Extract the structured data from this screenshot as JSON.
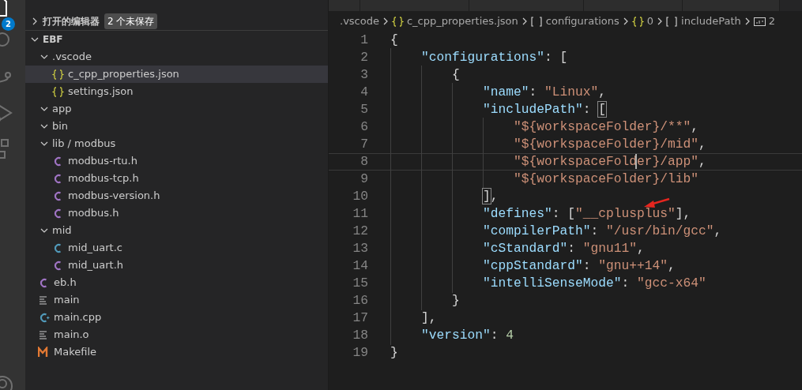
{
  "activity_bar": {
    "items": [
      {
        "kind": "explorer",
        "selected": true,
        "badge": "2"
      },
      {
        "kind": "search",
        "selected": false
      },
      {
        "kind": "source-control",
        "selected": false
      },
      {
        "kind": "run",
        "selected": false
      },
      {
        "kind": "extensions",
        "selected": false
      },
      {
        "kind": "account",
        "selected": false
      }
    ]
  },
  "sidebar": {
    "open_editors": {
      "label": "打开的编辑器",
      "expanded": false,
      "badge": "2 个未保存"
    },
    "root": {
      "label": "EBF",
      "expanded": true,
      "children": [
        {
          "label": ".vscode",
          "kind": "folder",
          "expanded": true,
          "children": [
            {
              "label": "c_cpp_properties.json",
              "kind": "json",
              "selected": true
            },
            {
              "label": "settings.json",
              "kind": "json",
              "selected": false
            }
          ]
        },
        {
          "label": "app",
          "kind": "folder",
          "expanded": true
        },
        {
          "label": "bin",
          "kind": "folder",
          "expanded": true
        },
        {
          "label": "lib / modbus",
          "kind": "folder",
          "expanded": true,
          "children": [
            {
              "label": "modbus-rtu.h",
              "kind": "c-header",
              "selected": false
            },
            {
              "label": "modbus-tcp.h",
              "kind": "c-header",
              "selected": false
            },
            {
              "label": "modbus-version.h",
              "kind": "c-header",
              "selected": false
            },
            {
              "label": "modbus.h",
              "kind": "c-header",
              "selected": false
            }
          ]
        },
        {
          "label": "mid",
          "kind": "folder",
          "expanded": true,
          "children": [
            {
              "label": "mid_uart.c",
              "kind": "c-source",
              "selected": false
            },
            {
              "label": "mid_uart.h",
              "kind": "c-header",
              "selected": false
            }
          ]
        },
        {
          "label": "eb.h",
          "kind": "c-header",
          "selected": false
        },
        {
          "label": "main",
          "kind": "text",
          "selected": false
        },
        {
          "label": "main.cpp",
          "kind": "cpp",
          "selected": false
        },
        {
          "label": "main.o",
          "kind": "text",
          "selected": false
        },
        {
          "label": "Makefile",
          "kind": "makefile",
          "selected": false
        }
      ]
    }
  },
  "editor": {
    "breadcrumb": [
      {
        "kind": "folder",
        "label": ".vscode"
      },
      {
        "kind": "object",
        "label": "c_cpp_properties.json"
      },
      {
        "kind": "array",
        "label": "configurations"
      },
      {
        "kind": "object",
        "label": "0"
      },
      {
        "kind": "array",
        "label": "includePath"
      },
      {
        "kind": "string",
        "label": "2"
      }
    ],
    "lines": [
      {
        "number": "1",
        "current": false,
        "tokens": [
          {
            "kind": "punct",
            "text": "{"
          }
        ]
      },
      {
        "number": "2",
        "current": false,
        "tokens": [
          {
            "kind": "key",
            "text": "    \"configurations\""
          },
          {
            "kind": "punct",
            "text": ": ["
          }
        ]
      },
      {
        "number": "3",
        "current": false,
        "tokens": [
          {
            "kind": "punct",
            "text": "        {"
          }
        ]
      },
      {
        "number": "4",
        "current": false,
        "tokens": [
          {
            "kind": "key",
            "text": "            \"name\""
          },
          {
            "kind": "punct",
            "text": ": "
          },
          {
            "kind": "string",
            "text": "\"Linux\""
          },
          {
            "kind": "punct",
            "text": ","
          }
        ]
      },
      {
        "number": "5",
        "current": false,
        "tokens": [
          {
            "kind": "key",
            "text": "            \"includePath\""
          },
          {
            "kind": "punct",
            "text": ": "
          },
          {
            "kind": "bracket-match",
            "text": "["
          }
        ]
      },
      {
        "number": "6",
        "current": false,
        "tokens": [
          {
            "kind": "string",
            "text": "                \"${workspaceFolder}/**\""
          },
          {
            "kind": "punct",
            "text": ","
          }
        ]
      },
      {
        "number": "7",
        "current": false,
        "tokens": [
          {
            "kind": "string",
            "text": "                \"${workspaceFolder}/mid\""
          },
          {
            "kind": "punct",
            "text": ","
          }
        ]
      },
      {
        "number": "8",
        "current": true,
        "tokens": [
          {
            "kind": "string",
            "text": "                \"${workspaceFold"
          },
          {
            "kind": "cursor",
            "text": "e"
          },
          {
            "kind": "string",
            "text": "r}/app\""
          },
          {
            "kind": "punct",
            "text": ","
          }
        ]
      },
      {
        "number": "9",
        "current": false,
        "tokens": [
          {
            "kind": "string",
            "text": "                \"${workspaceFolder}/lib\""
          }
        ]
      },
      {
        "number": "10",
        "current": false,
        "tokens": [
          {
            "kind": "bracket-match",
            "text": "            ]"
          },
          {
            "kind": "punct",
            "text": ","
          }
        ]
      },
      {
        "number": "11",
        "current": false,
        "arrow_marked": true,
        "tokens": [
          {
            "kind": "key",
            "text": "            \"defines\""
          },
          {
            "kind": "punct",
            "text": ": ["
          },
          {
            "kind": "string",
            "text": "\"__cplusplus\""
          },
          {
            "kind": "punct",
            "text": "],"
          }
        ]
      },
      {
        "number": "12",
        "current": false,
        "tokens": [
          {
            "kind": "key",
            "text": "            \"compilerPath\""
          },
          {
            "kind": "punct",
            "text": ": "
          },
          {
            "kind": "string",
            "text": "\"/usr/bin/gcc\""
          },
          {
            "kind": "punct",
            "text": ","
          }
        ]
      },
      {
        "number": "13",
        "current": false,
        "tokens": [
          {
            "kind": "key",
            "text": "            \"cStandard\""
          },
          {
            "kind": "punct",
            "text": ": "
          },
          {
            "kind": "string",
            "text": "\"gnu11\""
          },
          {
            "kind": "punct",
            "text": ","
          }
        ]
      },
      {
        "number": "14",
        "current": false,
        "tokens": [
          {
            "kind": "key",
            "text": "            \"cppStandard\""
          },
          {
            "kind": "punct",
            "text": ": "
          },
          {
            "kind": "string",
            "text": "\"gnu++14\""
          },
          {
            "kind": "punct",
            "text": ","
          }
        ]
      },
      {
        "number": "15",
        "current": false,
        "tokens": [
          {
            "kind": "key",
            "text": "            \"intelliSenseMode\""
          },
          {
            "kind": "punct",
            "text": ": "
          },
          {
            "kind": "string",
            "text": "\"gcc-x64\""
          }
        ]
      },
      {
        "number": "16",
        "current": false,
        "tokens": [
          {
            "kind": "punct",
            "text": "        }"
          }
        ]
      },
      {
        "number": "17",
        "current": false,
        "tokens": [
          {
            "kind": "punct",
            "text": "    ],"
          }
        ]
      },
      {
        "number": "18",
        "current": false,
        "tokens": [
          {
            "kind": "key",
            "text": "    \"version\""
          },
          {
            "kind": "punct",
            "text": ": "
          },
          {
            "kind": "number",
            "text": "4"
          }
        ]
      },
      {
        "number": "19",
        "current": false,
        "tokens": [
          {
            "kind": "punct",
            "text": "}"
          }
        ]
      }
    ]
  }
}
